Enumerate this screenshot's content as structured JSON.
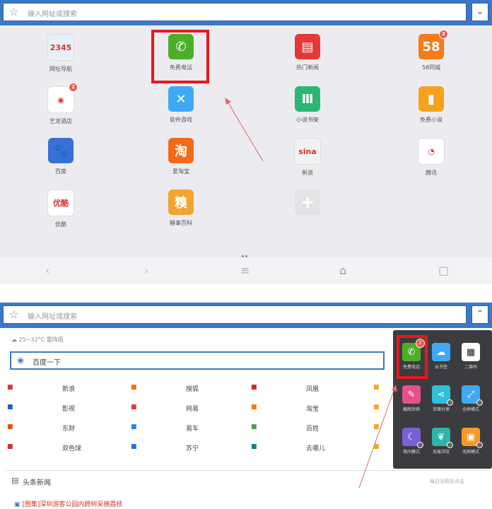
{
  "top_panel": {
    "address_placeholder": "输入网址或搜索",
    "tiles": [
      {
        "label": "网址导航",
        "icon": "2345-mascot-icon",
        "color": "#e8f0f8",
        "glyph": "2345"
      },
      {
        "label": "免费电话",
        "icon": "phone-icon",
        "color": "#4caf2a",
        "glyph": "✆"
      },
      {
        "label": "热门新闻",
        "icon": "news-icon",
        "color": "#e53935",
        "glyph": "▤"
      },
      {
        "label": "58同城",
        "icon": "58-icon",
        "color": "#f57c18",
        "glyph": "58"
      },
      {
        "label": "艺龙酒店",
        "icon": "elong-icon",
        "color": "#ffffff",
        "glyph": "◉"
      },
      {
        "label": "软件游戏",
        "icon": "app-store-icon",
        "color": "#3fa9f5",
        "glyph": "✕"
      },
      {
        "label": "小说书架",
        "icon": "bookshelf-icon",
        "color": "#2bb673",
        "glyph": "Ⅲ"
      },
      {
        "label": "免费小说",
        "icon": "book-icon",
        "color": "#f7a21b",
        "glyph": "▮"
      },
      {
        "label": "百度",
        "icon": "baidu-paw-icon",
        "color": "#3a6fd8",
        "glyph": "🐾"
      },
      {
        "label": "爱淘宝",
        "icon": "taobao-icon",
        "color": "#f56a17",
        "glyph": "淘"
      },
      {
        "label": "新浪",
        "icon": "sina-icon",
        "color": "#f2f2f2",
        "glyph": "sina"
      },
      {
        "label": "腾讯",
        "icon": "tencent-icon",
        "color": "#ffffff",
        "glyph": "◔"
      },
      {
        "label": "优酷",
        "icon": "youku-icon",
        "color": "#ffffff",
        "glyph": "优酷"
      },
      {
        "label": "糗事百科",
        "icon": "qiushi-icon",
        "color": "#f2a531",
        "glyph": "糗"
      },
      {
        "label": "",
        "icon": "add-icon",
        "color": "#e3e3e6",
        "glyph": "+"
      }
    ],
    "badge_count": "2"
  },
  "bottom_panel": {
    "address_placeholder": "输入网址或搜索",
    "weather": "25~32°C 雷阵雨",
    "search_text": "百度一下",
    "links": [
      [
        "新浪",
        "搜狐",
        "凤凰"
      ],
      [
        "影视",
        "网易",
        "淘宝"
      ],
      [
        "东财",
        "易车",
        "百姓"
      ],
      [
        "双色球",
        "苏宁",
        "去哪儿"
      ]
    ],
    "news_title": "头条新闻",
    "news_right": "每日@精彩点击",
    "news_item": "[图集]深圳游客公园内跨树采摘荔枝",
    "menu": [
      {
        "label": "免费电话",
        "icon": "phone-icon",
        "color": "#4caf2a",
        "glyph": "✆"
      },
      {
        "label": "云书签",
        "icon": "cloud-icon",
        "color": "#3fa9f5",
        "glyph": "☁"
      },
      {
        "label": "二维码",
        "icon": "qr-code-icon",
        "color": "#ffffff",
        "glyph": "▦"
      },
      {
        "label": "截图涂鸦",
        "icon": "screenshot-icon",
        "color": "#e84f8c",
        "glyph": "✎"
      },
      {
        "label": "页面分享",
        "icon": "share-icon",
        "color": "#2ec0d8",
        "glyph": "⋖"
      },
      {
        "label": "全屏模式",
        "icon": "fullscreen-icon",
        "color": "#3fa9f5",
        "glyph": "⤢"
      },
      {
        "label": "夜间模式",
        "icon": "moon-icon",
        "color": "#7b5fd6",
        "glyph": "☾"
      },
      {
        "label": "无痕浏览",
        "icon": "footprint-icon",
        "color": "#2bb6a8",
        "glyph": "❦"
      },
      {
        "label": "无图模式",
        "icon": "no-image-icon",
        "color": "#f59a2a",
        "glyph": "▣"
      }
    ]
  },
  "colors": {
    "accent": "#3c78c8",
    "highlight": "#e5191f"
  }
}
